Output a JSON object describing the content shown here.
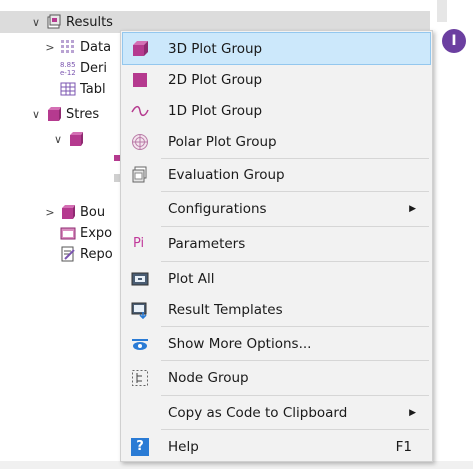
{
  "tree": {
    "items": [
      {
        "label": "Results",
        "arrow": "∨",
        "icon": "results-folder-icon"
      },
      {
        "label": "Data",
        "arrow": ">",
        "icon": "datasets-icon"
      },
      {
        "label": "Deri",
        "arrow": "",
        "icon": "derived-values-icon"
      },
      {
        "label": "Tabl",
        "arrow": "",
        "icon": "tables-icon"
      },
      {
        "label": "Stres",
        "arrow": "∨",
        "icon": "plot-group-icon"
      },
      {
        "label": "",
        "arrow": "∨",
        "icon": "plot-group-icon"
      },
      {
        "label": "Bou",
        "arrow": ">",
        "icon": "plot-group-icon"
      },
      {
        "label": "Expo",
        "arrow": "",
        "icon": "export-icon"
      },
      {
        "label": "Repo",
        "arrow": "",
        "icon": "reports-icon"
      }
    ]
  },
  "menu": {
    "items": [
      {
        "label": "3D Plot Group",
        "icon": "plot-group-3d-icon"
      },
      {
        "label": "2D Plot Group",
        "icon": "plot-group-2d-icon"
      },
      {
        "label": "1D Plot Group",
        "icon": "plot-group-1d-icon"
      },
      {
        "label": "Polar Plot Group",
        "icon": "polar-plot-group-icon"
      },
      {
        "label": "Evaluation Group",
        "icon": "evaluation-group-icon"
      },
      {
        "label": "Configurations",
        "icon": "",
        "submenu": "▶"
      },
      {
        "label": "Parameters",
        "icon": "parameters-icon",
        "icon_text": "Pi"
      },
      {
        "label": "Plot All",
        "icon": "plot-all-icon"
      },
      {
        "label": "Result Templates",
        "icon": "result-templates-icon"
      },
      {
        "label": "Show More Options...",
        "icon": "show-more-options-icon"
      },
      {
        "label": "Node Group",
        "icon": "node-group-icon"
      },
      {
        "label": "Copy as Code to Clipboard",
        "icon": "",
        "submenu": "▶"
      },
      {
        "label": "Help",
        "icon": "help-icon",
        "icon_text": "?",
        "shortcut": "F1"
      }
    ]
  },
  "badge": {
    "text": "I"
  },
  "colors": {
    "accent_hover": "#cce8fb",
    "plot_magenta": "#b53a8f",
    "badge_purple": "#6b3fa0",
    "help_blue": "#2a7bd5"
  }
}
